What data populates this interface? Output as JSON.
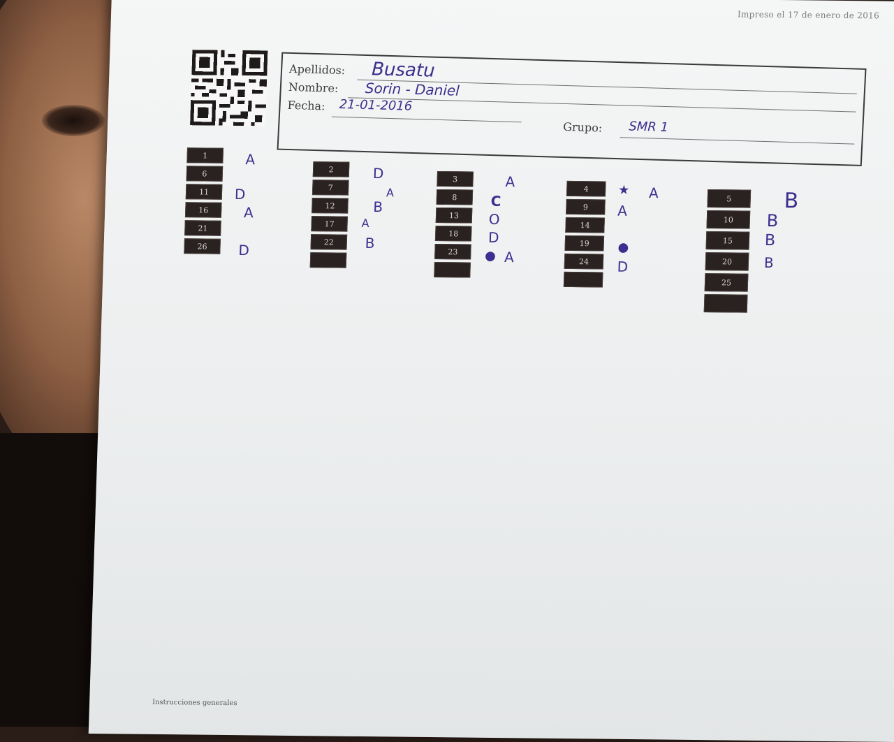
{
  "print_date": "Impreso el 17 de enero de 2016",
  "form": {
    "apellidos_label": "Apellidos:",
    "apellidos_value": "Busatu",
    "nombre_label": "Nombre:",
    "nombre_value": "Sorin - Daniel",
    "fecha_label": "Fecha:",
    "fecha_value": "21-01-2016",
    "grupo_label": "Grupo:",
    "grupo_value": "SMR 1"
  },
  "answer_columns": [
    {
      "questions": [
        "1",
        "6",
        "11",
        "16",
        "21",
        "26"
      ],
      "answers": [
        "A",
        "",
        "D",
        "A",
        "",
        "D"
      ]
    },
    {
      "questions": [
        "2",
        "7",
        "12",
        "17",
        "22",
        ""
      ],
      "answers": [
        "D",
        "A",
        "B",
        "A",
        "B",
        ""
      ]
    },
    {
      "questions": [
        "3",
        "8",
        "13",
        "18",
        "23",
        ""
      ],
      "answers": [
        "A",
        "C",
        "O",
        "D",
        "A",
        ""
      ]
    },
    {
      "questions": [
        "4",
        "9",
        "14",
        "19",
        "24",
        ""
      ],
      "answers": [
        "A",
        "A",
        "",
        "",
        "D",
        ""
      ]
    },
    {
      "questions": [
        "5",
        "10",
        "15",
        "20",
        "25",
        ""
      ],
      "answers": [
        "B",
        "B",
        "B",
        "B",
        "",
        ""
      ]
    }
  ],
  "footer_text": "Instrucciones generales"
}
